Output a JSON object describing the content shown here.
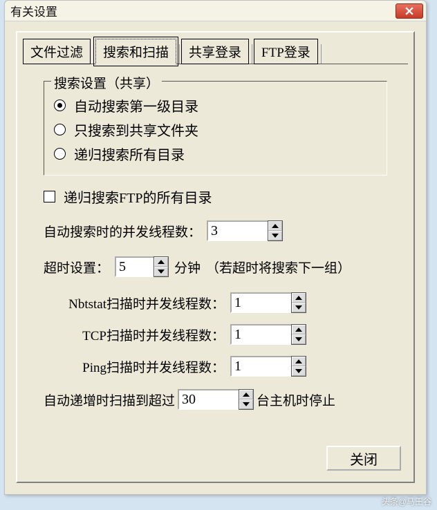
{
  "window": {
    "title": "有关设置"
  },
  "tabs": {
    "items": [
      {
        "label": "文件过滤"
      },
      {
        "label": "搜索和扫描"
      },
      {
        "label": "共享登录"
      },
      {
        "label": "FTP登录"
      }
    ],
    "active_index": 1
  },
  "group": {
    "title": "搜索设置（共享）",
    "radios": {
      "options": [
        {
          "label": "自动搜索第一级目录"
        },
        {
          "label": "只搜索到共享文件夹"
        },
        {
          "label": "递归搜索所有目录"
        }
      ],
      "selected_index": 0
    }
  },
  "ftp_recursive": {
    "label": "递归搜索FTP的所有目录",
    "checked": false
  },
  "threads": {
    "search": {
      "label": "自动搜索时的并发线程数：",
      "value": "3"
    }
  },
  "timeout": {
    "label": "超时设置：",
    "value": "5",
    "unit": "分钟",
    "hint": "（若超时将搜索下一组）"
  },
  "scan": {
    "nbtstat": {
      "label": "Nbtstat扫描时并发线程数：",
      "value": "1"
    },
    "tcp": {
      "label": "TCP扫描时并发线程数：",
      "value": "1"
    },
    "ping": {
      "label": "Ping扫描时并发线程数：",
      "value": "1"
    }
  },
  "autostop": {
    "prefix": "自动递增时扫描到超过",
    "value": "30",
    "suffix": "台主机时停止"
  },
  "buttons": {
    "close": "关闭"
  },
  "watermark": "头条@马王谷"
}
